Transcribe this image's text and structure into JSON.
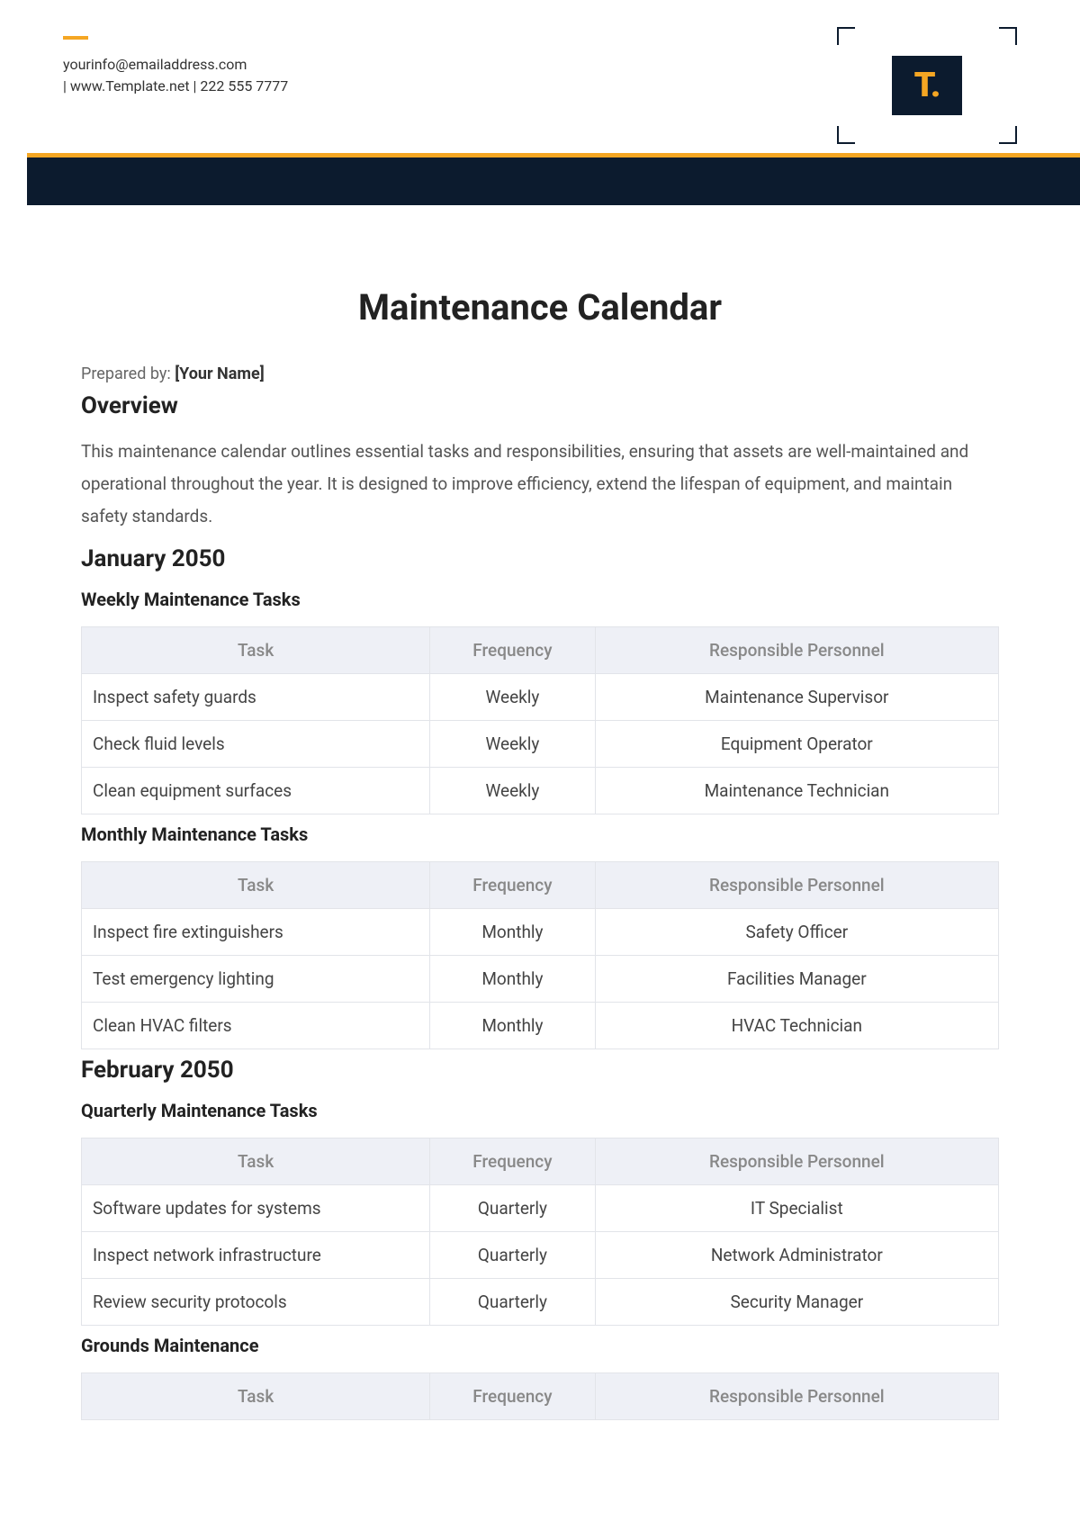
{
  "contact": {
    "email": "yourinfo@emailaddress.com",
    "line2": "|  www.Template.net  |  222 555 7777"
  },
  "logo_text": "T.",
  "title": "Maintenance Calendar",
  "prepared_label": "Prepared by: ",
  "prepared_name": "[Your Name]",
  "overview_heading": "Overview",
  "overview_text": "This maintenance calendar outlines essential tasks and responsibilities, ensuring that assets are well-maintained and operational throughout the year. It is designed to improve efficiency, extend the lifespan of equipment, and maintain safety standards.",
  "columns": {
    "task": "Task",
    "freq": "Frequency",
    "person": "Responsible Personnel"
  },
  "sections": [
    {
      "heading": "January 2050",
      "groups": [
        {
          "subheading": "Weekly Maintenance Tasks",
          "rows": [
            {
              "task": "Inspect safety guards",
              "freq": "Weekly",
              "person": "Maintenance Supervisor"
            },
            {
              "task": "Check fluid levels",
              "freq": "Weekly",
              "person": "Equipment Operator"
            },
            {
              "task": "Clean equipment surfaces",
              "freq": "Weekly",
              "person": "Maintenance Technician"
            }
          ]
        },
        {
          "subheading": "Monthly Maintenance Tasks",
          "rows": [
            {
              "task": "Inspect fire extinguishers",
              "freq": "Monthly",
              "person": "Safety Officer"
            },
            {
              "task": "Test emergency lighting",
              "freq": "Monthly",
              "person": "Facilities Manager"
            },
            {
              "task": "Clean HVAC filters",
              "freq": "Monthly",
              "person": "HVAC Technician"
            }
          ]
        }
      ]
    },
    {
      "heading": "February 2050",
      "groups": [
        {
          "subheading": "Quarterly Maintenance Tasks",
          "rows": [
            {
              "task": "Software updates for systems",
              "freq": "Quarterly",
              "person": "IT Specialist"
            },
            {
              "task": "Inspect network infrastructure",
              "freq": "Quarterly",
              "person": "Network Administrator"
            },
            {
              "task": "Review security protocols",
              "freq": "Quarterly",
              "person": "Security Manager"
            }
          ]
        },
        {
          "subheading": "Grounds Maintenance",
          "rows": []
        }
      ]
    }
  ]
}
